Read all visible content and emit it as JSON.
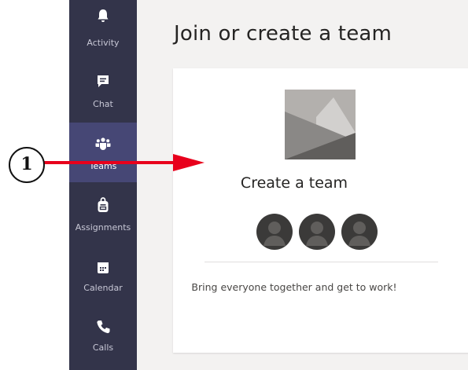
{
  "nav": {
    "items": [
      {
        "label": "Activity",
        "icon": "bell-icon"
      },
      {
        "label": "Chat",
        "icon": "chat-icon"
      },
      {
        "label": "Teams",
        "icon": "teams-icon",
        "active": true
      },
      {
        "label": "Assignments",
        "icon": "assignments-icon"
      },
      {
        "label": "Calendar",
        "icon": "calendar-icon"
      },
      {
        "label": "Calls",
        "icon": "phone-icon"
      }
    ]
  },
  "main": {
    "title": "Join or create a team",
    "card": {
      "title": "Create a team",
      "description": "Bring everyone together and get to work!"
    }
  },
  "annotation": {
    "callout_number": "1"
  },
  "colors": {
    "rail": "#33344a",
    "rail_active": "#464775",
    "annotation_arrow": "#e8001c",
    "content_bg": "#f3f2f1"
  }
}
